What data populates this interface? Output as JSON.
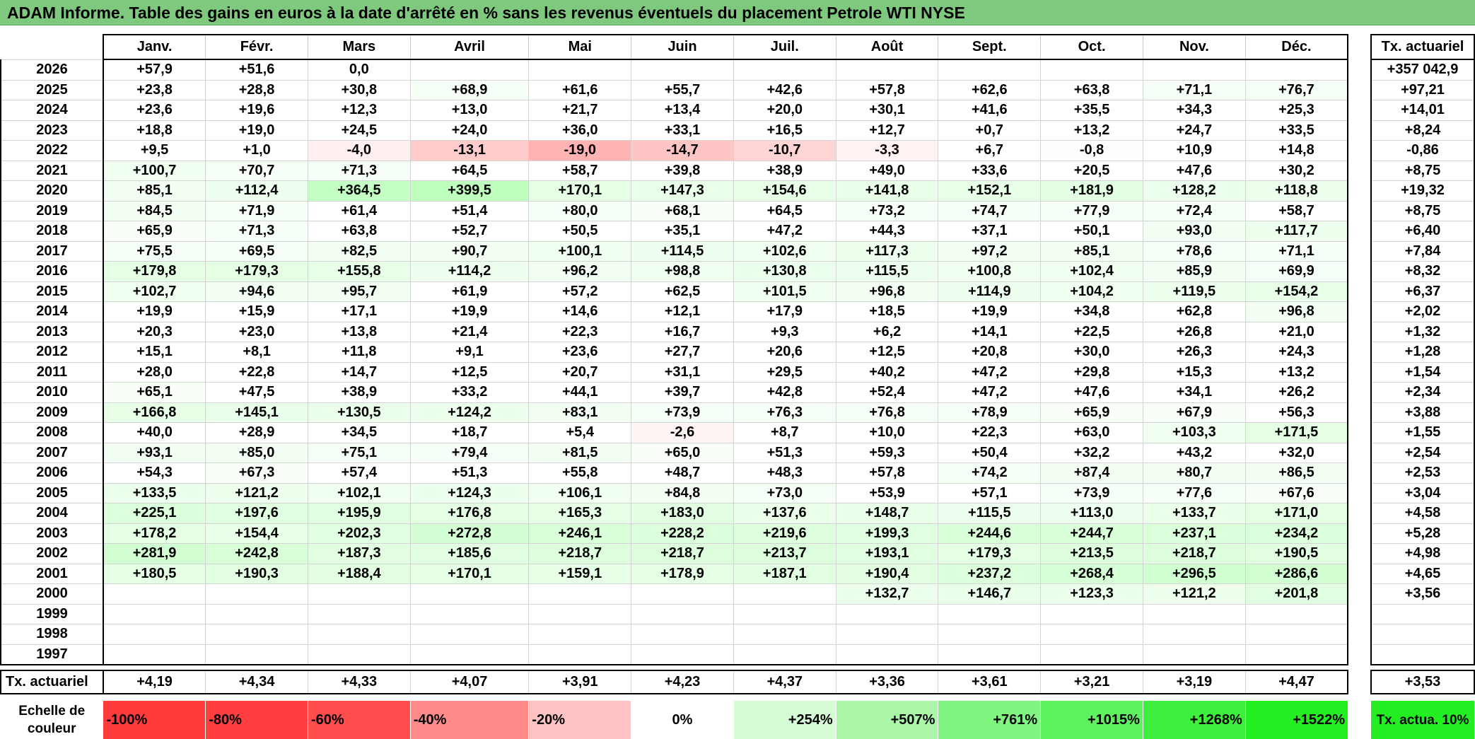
{
  "title": "ADAM Informe. Table des gains en euros à la date d'arrêté en % sans les revenus éventuels du placement Petrole WTI NYSE",
  "months": [
    "Janv.",
    "Févr.",
    "Mars",
    "Avril",
    "Mai",
    "Juin",
    "Juil.",
    "Août",
    "Sept.",
    "Oct.",
    "Nov.",
    "Déc."
  ],
  "tx_header": "Tx. actuariel",
  "rows": [
    {
      "year": "2026",
      "values": [
        "+57,9",
        "+51,6",
        "0,0",
        "",
        "",
        "",
        "",
        "",
        "",
        "",
        "",
        ""
      ],
      "tx": "+357 042,9"
    },
    {
      "year": "2025",
      "values": [
        "+23,8",
        "+28,8",
        "+30,8",
        "+68,9",
        "+61,6",
        "+55,7",
        "+42,6",
        "+57,8",
        "+62,6",
        "+63,8",
        "+71,1",
        "+76,7"
      ],
      "tx": "+97,21"
    },
    {
      "year": "2024",
      "values": [
        "+23,6",
        "+19,6",
        "+12,3",
        "+13,0",
        "+21,7",
        "+13,4",
        "+20,0",
        "+30,1",
        "+41,6",
        "+35,5",
        "+34,3",
        "+25,3"
      ],
      "tx": "+14,01"
    },
    {
      "year": "2023",
      "values": [
        "+18,8",
        "+19,0",
        "+24,5",
        "+24,0",
        "+36,0",
        "+33,1",
        "+16,5",
        "+12,7",
        "+0,7",
        "+13,2",
        "+24,7",
        "+33,5"
      ],
      "tx": "+8,24"
    },
    {
      "year": "2022",
      "values": [
        "+9,5",
        "+1,0",
        "-4,0",
        "-13,1",
        "-19,0",
        "-14,7",
        "-10,7",
        "-3,3",
        "+6,7",
        "-0,8",
        "+10,9",
        "+14,8"
      ],
      "tx": "-0,86"
    },
    {
      "year": "2021",
      "values": [
        "+100,7",
        "+70,7",
        "+71,3",
        "+64,5",
        "+58,7",
        "+39,8",
        "+38,9",
        "+49,0",
        "+33,6",
        "+20,5",
        "+47,6",
        "+30,2"
      ],
      "tx": "+8,75"
    },
    {
      "year": "2020",
      "values": [
        "+85,1",
        "+112,4",
        "+364,5",
        "+399,5",
        "+170,1",
        "+147,3",
        "+154,6",
        "+141,8",
        "+152,1",
        "+181,9",
        "+128,2",
        "+118,8"
      ],
      "tx": "+19,32"
    },
    {
      "year": "2019",
      "values": [
        "+84,5",
        "+71,9",
        "+61,4",
        "+51,4",
        "+80,0",
        "+68,1",
        "+64,5",
        "+73,2",
        "+74,7",
        "+77,9",
        "+72,4",
        "+58,7"
      ],
      "tx": "+8,75"
    },
    {
      "year": "2018",
      "values": [
        "+65,9",
        "+71,3",
        "+63,8",
        "+52,7",
        "+50,5",
        "+35,1",
        "+47,2",
        "+44,3",
        "+37,1",
        "+50,1",
        "+93,0",
        "+117,7"
      ],
      "tx": "+6,40"
    },
    {
      "year": "2017",
      "values": [
        "+75,5",
        "+69,5",
        "+82,5",
        "+90,7",
        "+100,1",
        "+114,5",
        "+102,6",
        "+117,3",
        "+97,2",
        "+85,1",
        "+78,6",
        "+71,1"
      ],
      "tx": "+7,84"
    },
    {
      "year": "2016",
      "values": [
        "+179,8",
        "+179,3",
        "+155,8",
        "+114,2",
        "+96,2",
        "+98,8",
        "+130,8",
        "+115,5",
        "+100,8",
        "+102,4",
        "+85,9",
        "+69,9"
      ],
      "tx": "+8,32"
    },
    {
      "year": "2015",
      "values": [
        "+102,7",
        "+94,6",
        "+95,7",
        "+61,9",
        "+57,2",
        "+62,5",
        "+101,5",
        "+96,8",
        "+114,9",
        "+104,2",
        "+119,5",
        "+154,2"
      ],
      "tx": "+6,37"
    },
    {
      "year": "2014",
      "values": [
        "+19,9",
        "+15,9",
        "+17,1",
        "+19,9",
        "+14,6",
        "+12,1",
        "+17,9",
        "+18,5",
        "+19,9",
        "+34,8",
        "+62,8",
        "+96,8"
      ],
      "tx": "+2,02"
    },
    {
      "year": "2013",
      "values": [
        "+20,3",
        "+23,0",
        "+13,8",
        "+21,4",
        "+22,3",
        "+16,7",
        "+9,3",
        "+6,2",
        "+14,1",
        "+22,5",
        "+26,8",
        "+21,0"
      ],
      "tx": "+1,32"
    },
    {
      "year": "2012",
      "values": [
        "+15,1",
        "+8,1",
        "+11,8",
        "+9,1",
        "+23,6",
        "+27,7",
        "+20,6",
        "+12,5",
        "+20,8",
        "+30,0",
        "+26,3",
        "+24,3"
      ],
      "tx": "+1,28"
    },
    {
      "year": "2011",
      "values": [
        "+28,0",
        "+22,8",
        "+14,7",
        "+12,5",
        "+20,7",
        "+31,1",
        "+29,5",
        "+40,2",
        "+47,2",
        "+29,8",
        "+15,3",
        "+13,2"
      ],
      "tx": "+1,54"
    },
    {
      "year": "2010",
      "values": [
        "+65,1",
        "+47,5",
        "+38,9",
        "+33,2",
        "+44,1",
        "+39,7",
        "+42,8",
        "+52,4",
        "+47,2",
        "+47,6",
        "+34,1",
        "+26,2"
      ],
      "tx": "+2,34"
    },
    {
      "year": "2009",
      "values": [
        "+166,8",
        "+145,1",
        "+130,5",
        "+124,2",
        "+83,1",
        "+73,9",
        "+76,3",
        "+76,8",
        "+78,9",
        "+65,9",
        "+67,9",
        "+56,3"
      ],
      "tx": "+3,88"
    },
    {
      "year": "2008",
      "values": [
        "+40,0",
        "+28,9",
        "+34,5",
        "+18,7",
        "+5,4",
        "-2,6",
        "+8,7",
        "+10,0",
        "+22,3",
        "+63,0",
        "+103,3",
        "+171,5"
      ],
      "tx": "+1,55"
    },
    {
      "year": "2007",
      "values": [
        "+93,1",
        "+85,0",
        "+75,1",
        "+79,4",
        "+81,5",
        "+65,0",
        "+51,3",
        "+59,3",
        "+50,4",
        "+32,2",
        "+43,2",
        "+32,0"
      ],
      "tx": "+2,54"
    },
    {
      "year": "2006",
      "values": [
        "+54,3",
        "+67,3",
        "+57,4",
        "+51,3",
        "+55,8",
        "+48,7",
        "+48,3",
        "+57,8",
        "+74,2",
        "+87,4",
        "+80,7",
        "+86,5"
      ],
      "tx": "+2,53"
    },
    {
      "year": "2005",
      "values": [
        "+133,5",
        "+121,2",
        "+102,1",
        "+124,3",
        "+106,1",
        "+84,8",
        "+73,0",
        "+53,9",
        "+57,1",
        "+73,9",
        "+77,6",
        "+67,6"
      ],
      "tx": "+3,04"
    },
    {
      "year": "2004",
      "values": [
        "+225,1",
        "+197,6",
        "+195,9",
        "+176,8",
        "+165,3",
        "+183,0",
        "+137,6",
        "+148,7",
        "+115,5",
        "+113,0",
        "+133,7",
        "+171,0"
      ],
      "tx": "+4,58"
    },
    {
      "year": "2003",
      "values": [
        "+178,2",
        "+154,4",
        "+202,3",
        "+272,8",
        "+246,1",
        "+228,2",
        "+219,6",
        "+199,3",
        "+244,6",
        "+244,7",
        "+237,1",
        "+234,2"
      ],
      "tx": "+5,28"
    },
    {
      "year": "2002",
      "values": [
        "+281,9",
        "+242,8",
        "+187,3",
        "+185,6",
        "+218,7",
        "+218,7",
        "+213,7",
        "+193,1",
        "+179,3",
        "+213,5",
        "+218,7",
        "+190,5"
      ],
      "tx": "+4,98"
    },
    {
      "year": "2001",
      "values": [
        "+180,5",
        "+190,3",
        "+188,4",
        "+170,1",
        "+159,1",
        "+178,9",
        "+187,1",
        "+190,4",
        "+237,2",
        "+268,4",
        "+296,5",
        "+286,6"
      ],
      "tx": "+4,65"
    },
    {
      "year": "2000",
      "values": [
        "",
        "",
        "",
        "",
        "",
        "",
        "",
        "+132,7",
        "+146,7",
        "+123,3",
        "+121,2",
        "+201,8"
      ],
      "tx": "+3,56"
    },
    {
      "year": "1999",
      "values": [
        "",
        "",
        "",
        "",
        "",
        "",
        "",
        "",
        "",
        "",
        "",
        ""
      ],
      "tx": ""
    },
    {
      "year": "1998",
      "values": [
        "",
        "",
        "",
        "",
        "",
        "",
        "",
        "",
        "",
        "",
        "",
        ""
      ],
      "tx": ""
    },
    {
      "year": "1997",
      "values": [
        "",
        "",
        "",
        "",
        "",
        "",
        "",
        "",
        "",
        "",
        "",
        ""
      ],
      "tx": ""
    }
  ],
  "summary": {
    "label": "Tx. actuariel",
    "values": [
      "+4,19",
      "+4,34",
      "+4,33",
      "+4,07",
      "+3,91",
      "+4,23",
      "+4,37",
      "+3,36",
      "+3,61",
      "+3,21",
      "+3,19",
      "+4,47"
    ],
    "tx": "+3,53"
  },
  "scale": {
    "label": "Echelle de couleur",
    "items": [
      {
        "label": "-100%",
        "color": "#ff3b3b",
        "kind": "neg"
      },
      {
        "label": "-80%",
        "color": "#ff3f3f",
        "kind": "neg"
      },
      {
        "label": "-60%",
        "color": "#ff4d4d",
        "kind": "neg"
      },
      {
        "label": "-40%",
        "color": "#ff8a8a",
        "kind": "neg"
      },
      {
        "label": "-20%",
        "color": "#ffc2c2",
        "kind": "neg"
      },
      {
        "label": "0%",
        "color": "#ffffff",
        "kind": "zero"
      },
      {
        "label": "+254%",
        "color": "#d6fcd6",
        "kind": "pos"
      },
      {
        "label": "+507%",
        "color": "#aaf7aa",
        "kind": "pos"
      },
      {
        "label": "+761%",
        "color": "#80f580",
        "kind": "pos"
      },
      {
        "label": "+1015%",
        "color": "#5ff25f",
        "kind": "pos"
      },
      {
        "label": "+1268%",
        "color": "#3df03d",
        "kind": "pos"
      },
      {
        "label": "+1522%",
        "color": "#22ee22",
        "kind": "pos"
      }
    ],
    "tx_label": "Tx. actua. 10%"
  }
}
